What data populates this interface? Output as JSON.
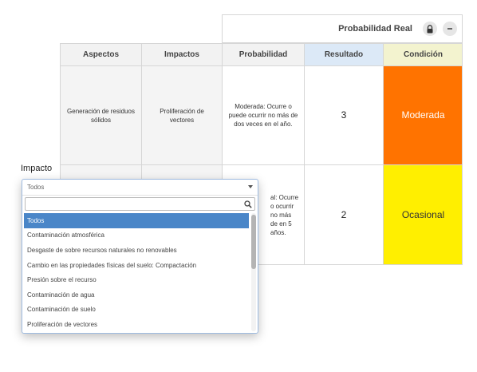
{
  "matrix": {
    "group_header": "Probabilidad Real",
    "columns": [
      "Aspectos",
      "Impactos",
      "Probabilidad",
      "Resultado",
      "Condición"
    ],
    "rows": [
      {
        "aspecto": "Generación de residuos sólidos",
        "impacto": "Proliferación de vectores",
        "probabilidad": "Moderada: Ocurre o puede ocurrir no más de dos veces en el año.",
        "resultado": "3",
        "condicion": "Moderada",
        "condicion_color": "#ff7300",
        "condicion_text_color": "#ffffff"
      },
      {
        "aspecto": "",
        "impacto": "",
        "probabilidad": "al: Ocurre o ocurrir no más de en 5 años.",
        "resultado": "2",
        "condicion": "Ocasional",
        "condicion_color": "#ffef00",
        "condicion_text_color": "#333333"
      }
    ]
  },
  "filter": {
    "label": "Impacto",
    "selected_value": "Todos",
    "search_value": "",
    "options": [
      "Todos",
      "Contaminación atmosférica",
      "Desgaste de sobre recursos naturales no renovables",
      "Cambio en las propiedades físicas del suelo: Compactación",
      "Presión sobre el recurso",
      "Contaminación de agua",
      "Contaminación de suelo",
      "Proliferación de vectores"
    ]
  },
  "icons": {
    "lock": "lock-icon",
    "collapse": "minus-icon",
    "search": "search-icon",
    "dropdown": "chevron-down-icon"
  },
  "colors": {
    "accent": "#4a86c8",
    "moderada": "#ff7300",
    "ocasional": "#ffef00",
    "resultado_header": "#dce9f7",
    "condicion_header": "#f3f3cf"
  }
}
